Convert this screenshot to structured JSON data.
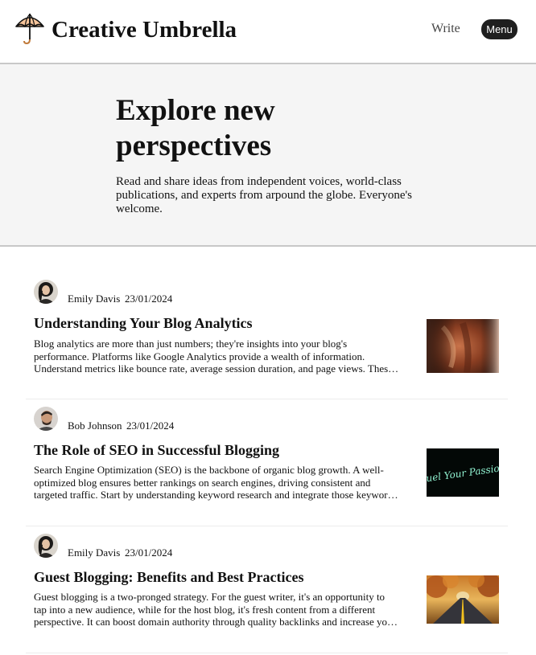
{
  "header": {
    "brand": "Creative Umbrella",
    "logo_icon": "umbrella-icon",
    "write_label": "Write",
    "menu_label": "Menu"
  },
  "hero": {
    "title": "Explore new perspectives",
    "description": "Read and share ideas from independent voices, world-class publications, and experts from arpound the globe. Everyone's welcome."
  },
  "articles": [
    {
      "author": "Emily Davis",
      "date": "23/01/2024",
      "title": "Understanding Your Blog Analytics",
      "excerpt": "Blog analytics are more than just numbers; they're insights into your blog's performance. Platforms like Google Analytics provide a wealth of information. Understand metrics like bounce rate, average session duration, and page views. These metrics help you understand how readers interact with your content.",
      "thumbnail": "abstract-orange-image"
    },
    {
      "author": "Bob Johnson",
      "date": "23/01/2024",
      "title": "The Role of SEO in Successful Blogging",
      "excerpt": "Search Engine Optimization (SEO) is the backbone of organic blog growth. A well-optimized blog ensures better rankings on search engines, driving consistent and targeted traffic. Start by understanding keyword research and integrate those keywords naturally into your content.",
      "thumbnail": "fuel-your-passion-neon-image",
      "thumbnail_text": "Fuel Your Passion"
    },
    {
      "author": "Emily Davis",
      "date": "23/01/2024",
      "title": "Guest Blogging: Benefits and Best Practices",
      "excerpt": "Guest blogging is a two-pronged strategy. For the guest writer, it's an opportunity to tap into a new audience, while for the host blog, it's fresh content from a different perspective. It can boost domain authority through quality backlinks and increase your visibility in your niche.",
      "thumbnail": "autumn-road-image"
    }
  ],
  "colors": {
    "menu_button_bg": "#1f1f1f",
    "hero_bg": "#f5f5f5",
    "divider": "#c8c8c8"
  }
}
